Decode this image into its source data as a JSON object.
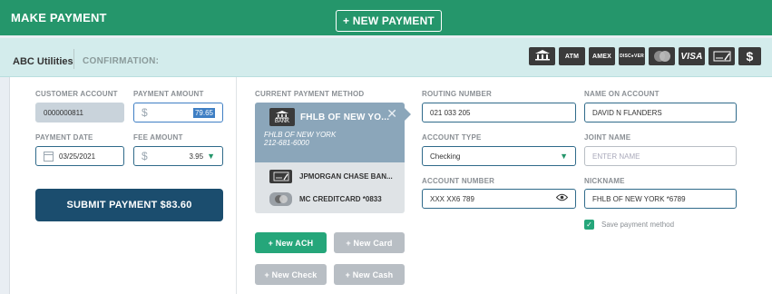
{
  "header": {
    "title": "MAKE PAYMENT",
    "new_payment_label": "+ NEW PAYMENT",
    "bg_color": "#25966b"
  },
  "subheader": {
    "company": "ABC Utilities",
    "tab_confirmation": "CONFIRMATION:",
    "payment_icons": [
      "bank-icon",
      "atm-icon",
      "amex-icon",
      "discover-icon",
      "mastercard-icon",
      "visa-icon",
      "check-icon",
      "dollar-icon"
    ],
    "icon_labels": {
      "bank": "BANK",
      "atm": "ATM",
      "amex": "AMEX",
      "discover": "DISC●VER",
      "mastercard": "MasterCard",
      "visa": "VISA",
      "check": "CHECK",
      "dollar": "$"
    }
  },
  "left": {
    "customer_account_label": "CUSTOMER ACCOUNT",
    "customer_account_value": "0000000811",
    "payment_amount_label": "PAYMENT AMOUNT",
    "payment_amount_value": "79.65",
    "payment_date_label": "PAYMENT DATE",
    "payment_date_value": "03/25/2021",
    "fee_amount_label": "FEE AMOUNT",
    "fee_amount_value": "3.95",
    "currency_symbol": "$",
    "submit_label": "SUBMIT PAYMENT $83.60"
  },
  "payment_methods": {
    "label": "CURRENT PAYMENT METHOD",
    "selected": {
      "name": "FHLB OF NEW YO...",
      "sub1": "FHLB OF NEW YORK",
      "sub2": "212-681-6000",
      "icon_label": "BANK"
    },
    "items": [
      {
        "name": "JPMORGAN CHASE BAN...",
        "icon": "check-icon",
        "icon_label": "CHECK"
      },
      {
        "name": "MC CREDITCARD *0833",
        "icon": "mastercard-icon",
        "icon_label": "MasterCard"
      }
    ],
    "buttons": {
      "new_ach": "+ New ACH",
      "new_card": "+ New Card",
      "new_check": "+ New Check",
      "new_cash": "+ New Cash"
    }
  },
  "form": {
    "routing_number_label": "ROUTING NUMBER",
    "routing_number_value": "021 033 205",
    "name_on_account_label": "NAME ON ACCOUNT",
    "name_on_account_value": "DAVID N FLANDERS",
    "account_type_label": "ACCOUNT TYPE",
    "account_type_value": "Checking",
    "joint_name_label": "JOINT NAME",
    "joint_name_placeholder": "ENTER NAME",
    "account_number_label": "ACCOUNT NUMBER",
    "account_number_value": "XXX XX6 789",
    "nickname_label": "NICKNAME",
    "nickname_value": "FHLB OF NEW YORK *6789",
    "save_method_label": "Save payment method"
  }
}
